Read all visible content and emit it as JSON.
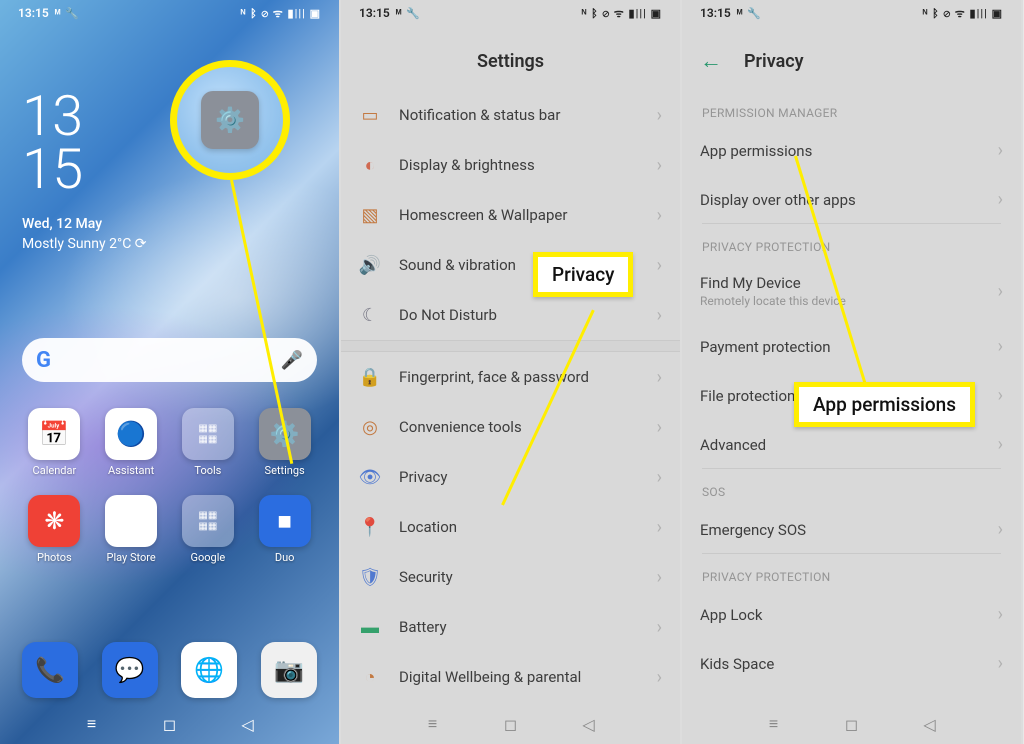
{
  "status": {
    "time": "13:15",
    "icons_left": "ᴹ 🔧",
    "icons_right": "ᴺ ᛒ ⊘ ᯤ ▮||| ▣"
  },
  "home": {
    "clock_top": "13",
    "clock_bottom": "15",
    "date": "Wed, 12 May",
    "weather": "Mostly Sunny 2°C ⟳",
    "apps": {
      "calendar": "Calendar",
      "assistant": "Assistant",
      "tools": "Tools",
      "settings": "Settings",
      "photos": "Photos",
      "playstore": "Play Store",
      "google": "Google",
      "duo": "Duo"
    }
  },
  "callouts": {
    "privacy": "Privacy",
    "app_permissions": "App permissions"
  },
  "settings": {
    "title": "Settings",
    "items": [
      {
        "label": "Notification & status bar"
      },
      {
        "label": "Display & brightness"
      },
      {
        "label": "Homescreen & Wallpaper"
      },
      {
        "label": "Sound & vibration"
      },
      {
        "label": "Do Not Disturb"
      },
      {
        "label": "Fingerprint, face & password"
      },
      {
        "label": "Convenience tools"
      },
      {
        "label": "Privacy"
      },
      {
        "label": "Location"
      },
      {
        "label": "Security"
      },
      {
        "label": "Battery"
      },
      {
        "label": "Digital Wellbeing & parental"
      }
    ]
  },
  "privacy": {
    "title": "Privacy",
    "sections": {
      "perm_mgr": "PERMISSION MANAGER",
      "priv_prot": "PRIVACY PROTECTION",
      "sos": "SOS",
      "priv_prot2": "PRIVACY PROTECTION"
    },
    "items": {
      "app_perm": "App permissions",
      "disp_over": "Display over other apps",
      "find_device": "Find My Device",
      "find_device_sub": "Remotely locate this device",
      "payment": "Payment protection",
      "file": "File protection",
      "advanced": "Advanced",
      "esos": "Emergency SOS",
      "applock": "App Lock",
      "kids": "Kids Space"
    }
  }
}
